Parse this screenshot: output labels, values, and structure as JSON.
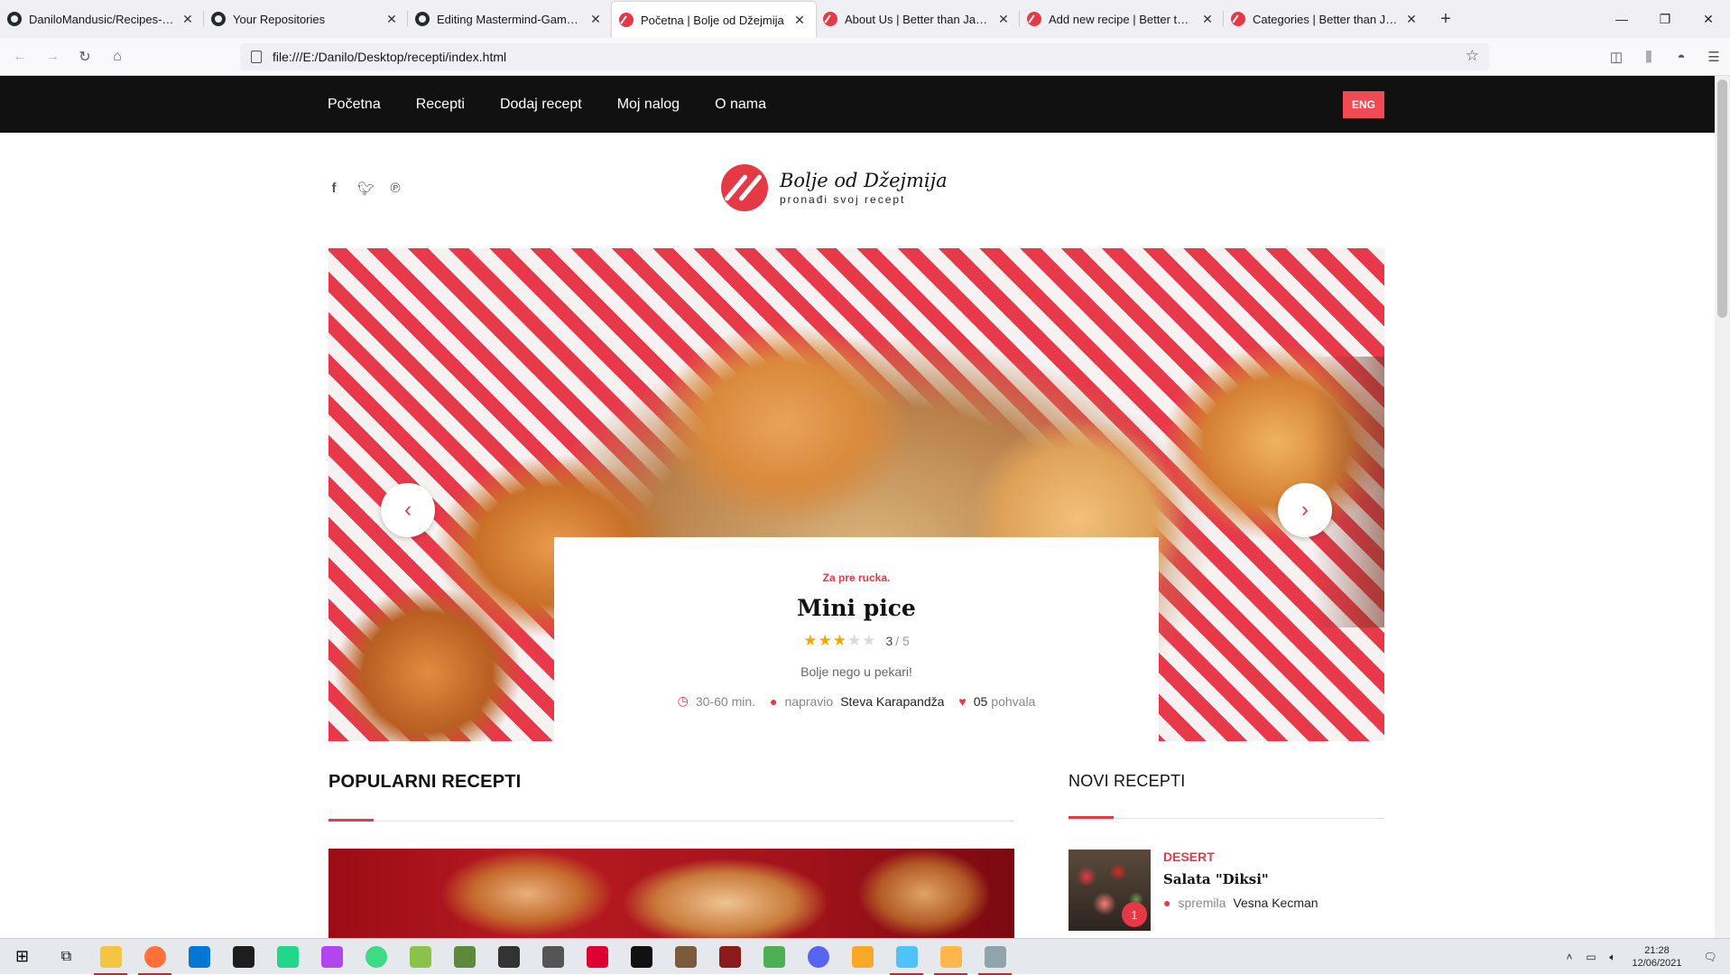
{
  "browser": {
    "tabs": [
      {
        "label": "DaniloMandusic/Recipes-Book",
        "favicon": "github-icon",
        "active": false
      },
      {
        "label": "Your Repositories",
        "favicon": "github-icon",
        "active": false
      },
      {
        "label": "Editing Mastermind-Game/README.md",
        "favicon": "github-icon",
        "active": false
      },
      {
        "label": "Početna | Bolje od Džejmija",
        "favicon": "site-logo-icon",
        "active": true
      },
      {
        "label": "About Us | Better than Jamie",
        "favicon": "site-logo-icon",
        "active": false
      },
      {
        "label": "Add new recipe | Better than Jamie",
        "favicon": "site-logo-icon",
        "active": false
      },
      {
        "label": "Categories | Better than Jamie",
        "favicon": "site-logo-icon",
        "active": false
      }
    ],
    "url": "file:///E:/Danilo/Desktop/recepti/index.html"
  },
  "site": {
    "nav": [
      "Početna",
      "Recepti",
      "Dodaj recept",
      "Moj nalog",
      "O nama"
    ],
    "lang_button": "ENG",
    "logo_title": "Bolje od Džejmija",
    "logo_subtitle": "pronađi svoj recept",
    "slider": {
      "category": "Za pre rucka.",
      "title": "Mini pice",
      "rating_value": "3",
      "rating_max": "/ 5",
      "rating_stars": 3,
      "description": "Bolje nego u pekari!",
      "time": "30-60 min.",
      "author_prefix": "napravio",
      "author": "Steva Karapandža",
      "likes_count": "05",
      "likes_label": "pohvala"
    },
    "popular_title": "POPULARNI RECEPTI",
    "new_title": "NOVI RECEPTI",
    "new_item": {
      "category": "DESERT",
      "title": "Salata \"Diksi\"",
      "author_prefix": "spremila",
      "author": "Vesna Kecman",
      "badge": "1"
    },
    "accent_color": "#e63946"
  },
  "taskbar": {
    "time": "21:28",
    "date": "12/06/2021"
  }
}
